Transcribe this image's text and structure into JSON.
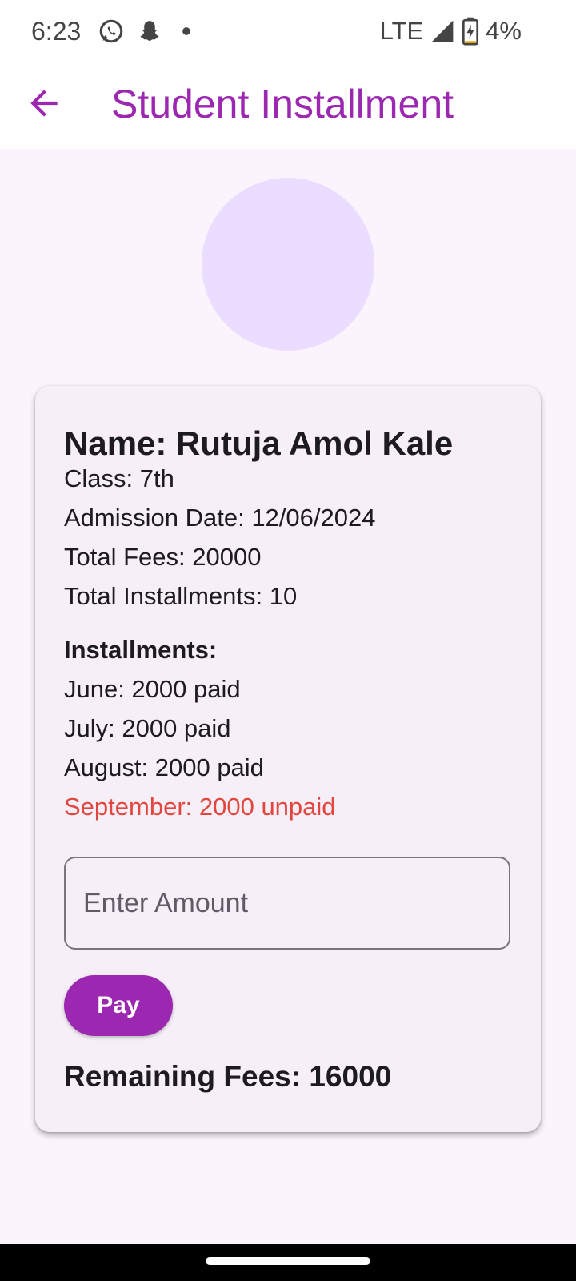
{
  "status_bar": {
    "time": "6:23",
    "network": "LTE",
    "battery": "4%",
    "left_icons": [
      "whatsapp-icon",
      "snapchat-icon",
      "dot-icon"
    ],
    "right_icons": [
      "signal-icon",
      "battery-charging-icon"
    ]
  },
  "appbar": {
    "title": "Student Installment",
    "back_icon": "arrow-back-icon"
  },
  "student": {
    "name": "Name: Rutuja Amol Kale",
    "class": "Class: 7th",
    "admission_date": "Admission Date: 12/06/2024",
    "total_fees": "Total Fees: 20000",
    "total_installments": "Total Installments: 10"
  },
  "installments": {
    "title": "Installments:",
    "items": [
      {
        "text": "June: 2000 paid",
        "status": "paid"
      },
      {
        "text": "July: 2000 paid",
        "status": "paid"
      },
      {
        "text": "August: 2000 paid",
        "status": "paid"
      },
      {
        "text": "September: 2000 unpaid",
        "status": "unpaid"
      }
    ]
  },
  "payment": {
    "amount_placeholder": "Enter Amount",
    "amount_value": "",
    "pay_label": "Pay"
  },
  "remaining": "Remaining Fees: 16000",
  "colors": {
    "accent": "#9C27B0",
    "background": "#FCF4FC",
    "card": "#F6EFF7",
    "avatar": "#EADDFF",
    "unpaid": "#E3463E",
    "text": "#1D1B20"
  }
}
